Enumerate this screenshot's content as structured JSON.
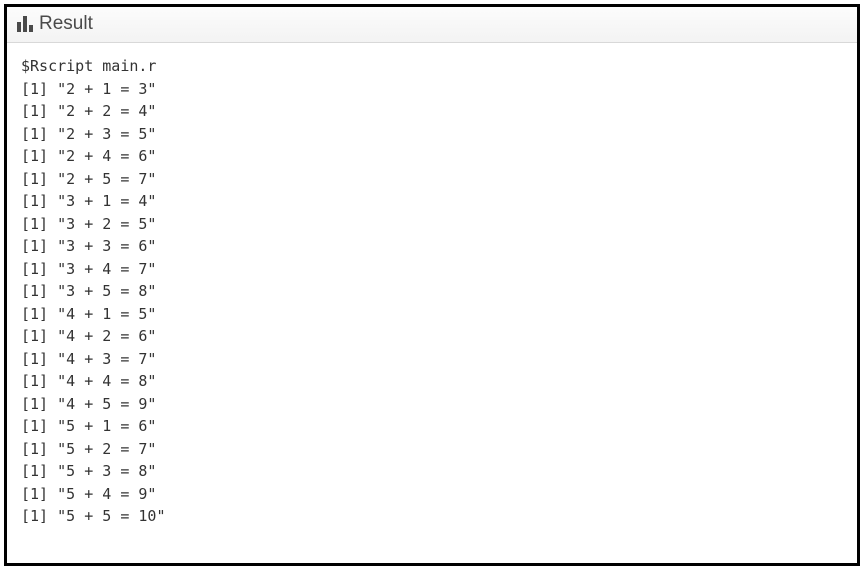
{
  "header": {
    "title": "Result"
  },
  "console": {
    "command": "$Rscript main.r",
    "lines": [
      "[1] \"2 + 1 = 3\"",
      "[1] \"2 + 2 = 4\"",
      "[1] \"2 + 3 = 5\"",
      "[1] \"2 + 4 = 6\"",
      "[1] \"2 + 5 = 7\"",
      "[1] \"3 + 1 = 4\"",
      "[1] \"3 + 2 = 5\"",
      "[1] \"3 + 3 = 6\"",
      "[1] \"3 + 4 = 7\"",
      "[1] \"3 + 5 = 8\"",
      "[1] \"4 + 1 = 5\"",
      "[1] \"4 + 2 = 6\"",
      "[1] \"4 + 3 = 7\"",
      "[1] \"4 + 4 = 8\"",
      "[1] \"4 + 5 = 9\"",
      "[1] \"5 + 1 = 6\"",
      "[1] \"5 + 2 = 7\"",
      "[1] \"5 + 3 = 8\"",
      "[1] \"5 + 4 = 9\"",
      "[1] \"5 + 5 = 10\""
    ]
  }
}
